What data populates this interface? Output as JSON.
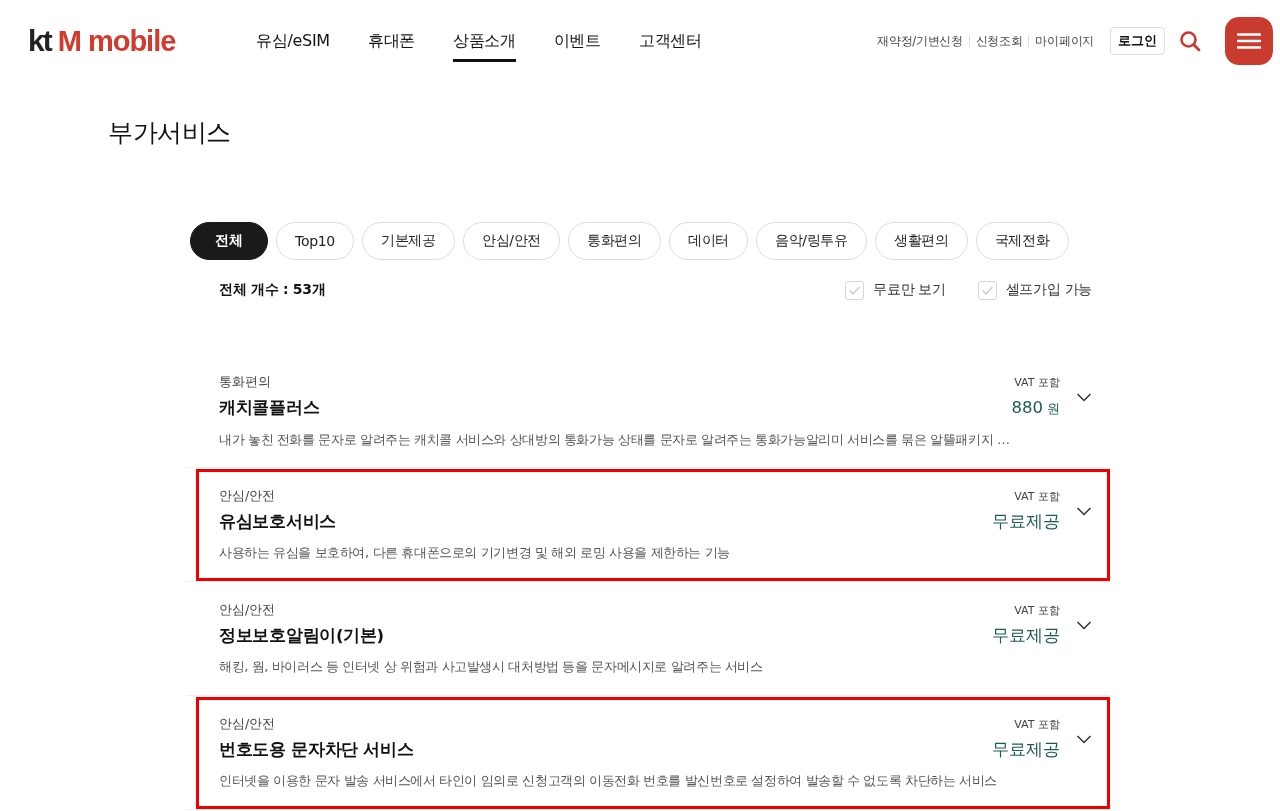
{
  "header": {
    "logo": {
      "prefix": "kt",
      "name": "M mobile"
    },
    "nav": [
      {
        "label": "유심/eSIM",
        "selected": false
      },
      {
        "label": "휴대폰",
        "selected": false
      },
      {
        "label": "상품소개",
        "selected": true
      },
      {
        "label": "이벤트",
        "selected": false
      },
      {
        "label": "고객센터",
        "selected": false
      }
    ],
    "util_links": [
      "재약정/기변신청",
      "신청조회",
      "마이페이지"
    ],
    "login_button": "로그인"
  },
  "page_title": "부가서비스",
  "filters": [
    {
      "label": "전체",
      "selected": true
    },
    {
      "label": "Top10",
      "selected": false
    },
    {
      "label": "기본제공",
      "selected": false
    },
    {
      "label": "안심/안전",
      "selected": false
    },
    {
      "label": "통화편의",
      "selected": false
    },
    {
      "label": "데이터",
      "selected": false
    },
    {
      "label": "음악/링투유",
      "selected": false
    },
    {
      "label": "생활편의",
      "selected": false
    },
    {
      "label": "국제전화",
      "selected": false
    }
  ],
  "total_count": "전체 개수 : 53개",
  "options": [
    {
      "label": "무료만 보기",
      "checked": false
    },
    {
      "label": "셀프가입 가능",
      "checked": false
    }
  ],
  "services": [
    {
      "category": "통화편의",
      "name": "캐치콜플러스",
      "vat_note": "VAT 포함",
      "price": "880",
      "unit": "원",
      "description": "내가 놓친 전화를 문자로 알려주는 캐치콜 서비스와 상대방의 통화가능 상태를 문자로 알려주는 통화가능알리미 서비스를 묶은 알뜰패키지 …",
      "expanded": false,
      "highlighted": false
    },
    {
      "category": "안심/안전",
      "name": "유심보호서비스",
      "vat_note": "VAT 포함",
      "price": "무료제공",
      "description": "사용하는 유심을 보호하여, 다른 휴대폰으로의 기기변경 및 해외 로밍 사용을 제한하는 기능",
      "expanded": false,
      "highlighted": true
    },
    {
      "category": "안심/안전",
      "name": "정보보호알림이(기본)",
      "vat_note": "VAT 포함",
      "price": "무료제공",
      "description": "해킹, 웜, 바이러스 등 인터넷 상 위험과 사고발생시 대처방법 등을 문자메시지로 알려주는 서비스",
      "expanded": false,
      "highlighted": false
    },
    {
      "category": "안심/안전",
      "name": "번호도용 문자차단 서비스",
      "vat_note": "VAT 포함",
      "price": "무료제공",
      "description": "인터넷을 이용한 문자 발송 서비스에서 타인이 임의로 신청고객의 이동전화 번호를 발신번호로 설정하여 발송할 수 없도록 차단하는 서비스",
      "expanded": false,
      "highlighted": true
    }
  ]
}
